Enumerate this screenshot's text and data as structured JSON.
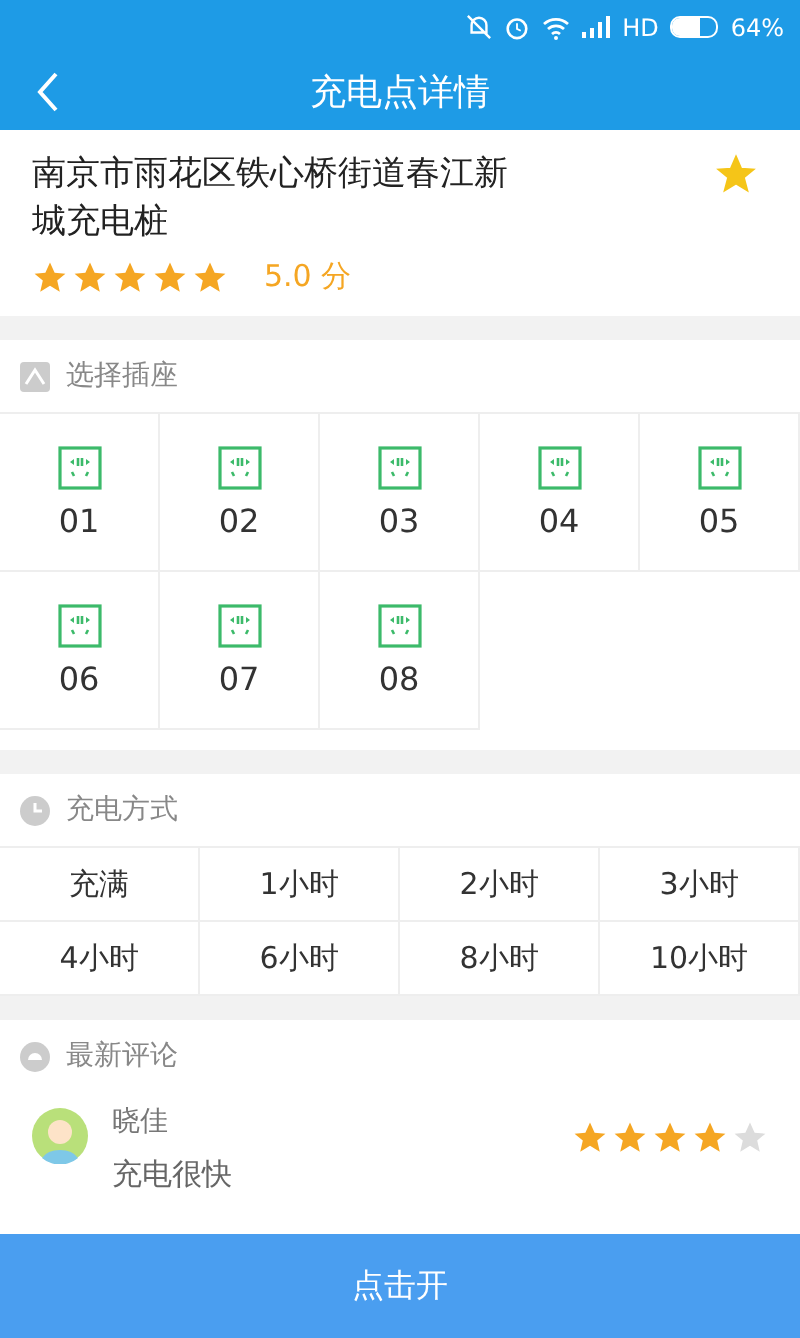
{
  "status_bar": {
    "network": "HD",
    "battery": "64%"
  },
  "header": {
    "title": "充电点详情"
  },
  "station": {
    "name": "南京市雨花区铁心桥街道春江新城充电桩",
    "favorite": true,
    "stars": 5,
    "score": "5.0 分"
  },
  "sockets": {
    "title": "选择插座",
    "items": [
      {
        "label": "01"
      },
      {
        "label": "02"
      },
      {
        "label": "03"
      },
      {
        "label": "04"
      },
      {
        "label": "05"
      },
      {
        "label": "06"
      },
      {
        "label": "07"
      },
      {
        "label": "08"
      }
    ]
  },
  "charge_modes": {
    "title": "充电方式",
    "items": [
      {
        "label": "充满",
        "selected": false
      },
      {
        "label": "1小时",
        "selected": false
      },
      {
        "label": "2小时",
        "selected": false
      },
      {
        "label": "3小时",
        "selected": false
      },
      {
        "label": "4小时",
        "selected": false
      },
      {
        "label": "6小时",
        "selected": false
      },
      {
        "label": "8小时",
        "selected": false
      },
      {
        "label": "10小时",
        "selected": false
      }
    ]
  },
  "reviews": {
    "title": "最新评论",
    "items": [
      {
        "user": "晓佳",
        "stars": 4,
        "text": "充电很快"
      }
    ]
  },
  "action_button": "点击开"
}
